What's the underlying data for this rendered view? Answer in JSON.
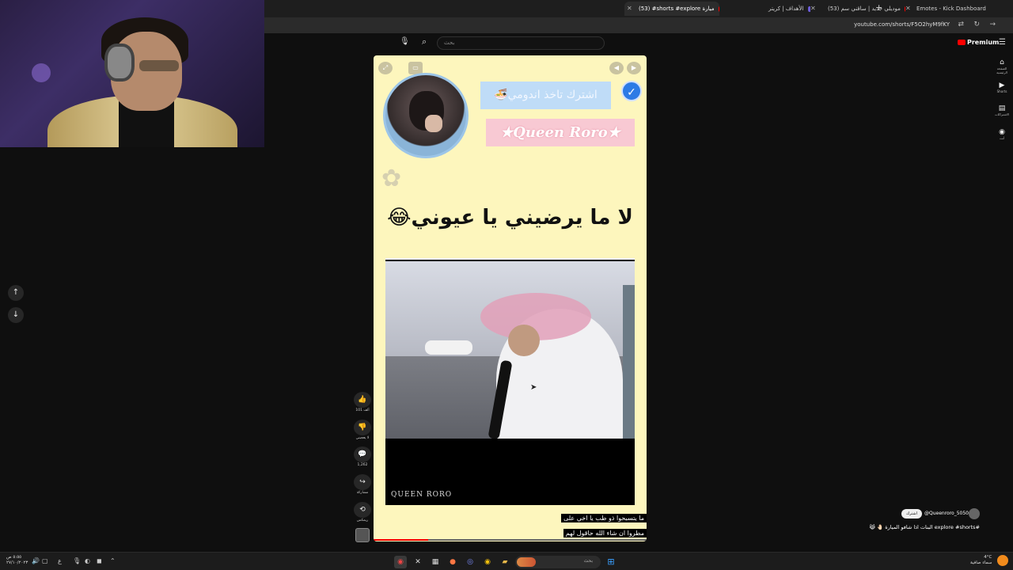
{
  "browser": {
    "tabs": [
      {
        "label": "Emotes - Kick Dashboard"
      },
      {
        "label": "(53) موديلي جديد | ساقني سم"
      },
      {
        "label": "الأهداف | كريتر"
      },
      {
        "label": "(53) #shorts #explore ميارة"
      }
    ],
    "url": "youtube.com/shorts/F5O2hyM9fKY"
  },
  "youtube": {
    "search_placeholder": "بحث",
    "premium_label": "Premium",
    "guide": [
      {
        "icon": "home-icon",
        "label": "الصفحة الرئيسية"
      },
      {
        "icon": "shorts-icon",
        "label": "Shorts"
      },
      {
        "icon": "subscriptions-icon",
        "label": "الاشتراكات"
      },
      {
        "icon": "you-icon",
        "label": "أنت"
      }
    ]
  },
  "short": {
    "subscribe_text": "اشترك تاخذ اندومي🍜",
    "channel_banner": "★Queen Roro★",
    "caption": "لا ما يرضيني يا عيوني😂",
    "watermark": "QUEEN RORO",
    "subtitle_line1": "ما يتسبحوا ذو طب يا اخي على",
    "subtitle_line2": "مطروا ان شاء الله حاقول لهم",
    "progress": 0.2
  },
  "actions": {
    "like_count": "101 ألف",
    "dislike_label": "لا يعجبني",
    "comments_count": "1,262",
    "share_label": "مشاركة",
    "remix_label": "ريمكس"
  },
  "channel": {
    "subscribe_label": "اشترك",
    "handle": "@Queenroro_5050",
    "title": "#explore #shorts البنات اذا شافو الميارة 🤚🏻 😹"
  },
  "taskbar": {
    "time": "٥:٥٥ ص",
    "date": "٢٧/١٠/٢٠٢٣",
    "search_text": "بحث",
    "weather_temp": "4°C",
    "weather_text": "سماء صافية"
  },
  "colors": {
    "short_bg": "#fdf6bd",
    "accent_red": "#ff0000",
    "verified_blue": "#2d7be5"
  }
}
